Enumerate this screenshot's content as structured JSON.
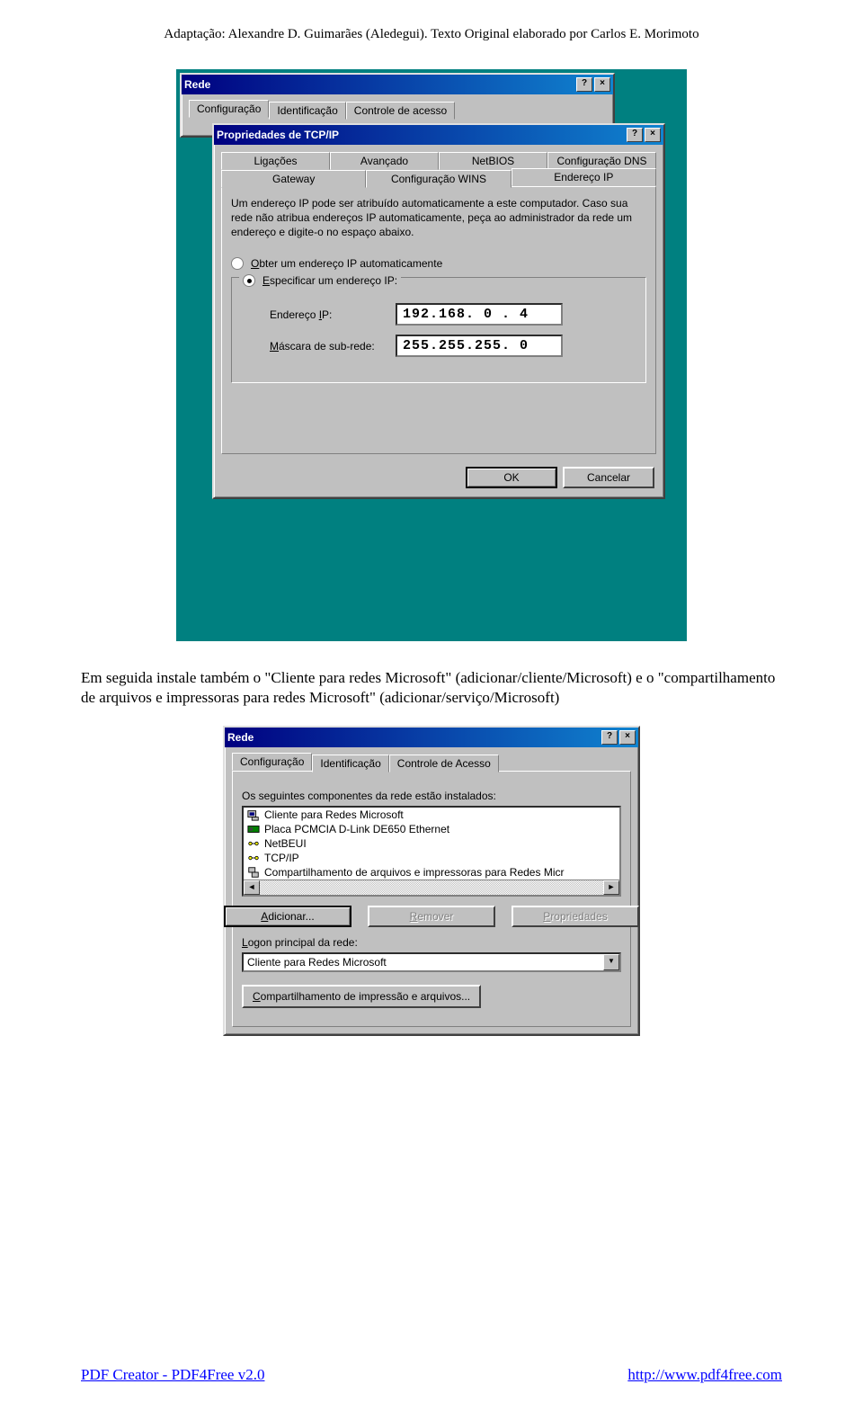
{
  "header": "Adaptação: Alexandre D. Guimarães (Aledegui). Texto Original elaborado por Carlos E. Morimoto",
  "screenshot1": {
    "back_window": {
      "title": "Rede",
      "tabs": [
        "Configuração",
        "Identificação",
        "Controle de acesso"
      ]
    },
    "front_window": {
      "title": "Propriedades de TCP/IP",
      "tabs_row1": [
        "Ligações",
        "Avançado",
        "NetBIOS",
        "Configuração DNS"
      ],
      "tabs_row2": [
        "Gateway",
        "Configuração WINS",
        "Endereço IP"
      ],
      "explain": "Um endereço IP pode ser atribuído automaticamente a este computador. Caso sua rede não atribua endereços IP automaticamente, peça ao administrador da rede um endereço e digite-o no espaço abaixo.",
      "radio_auto": "Obter um endereço IP automaticamente",
      "radio_spec": "Especificar um endereço IP:",
      "ip_label": "Endereço IP:",
      "ip_value": "192.168. 0 . 4",
      "mask_label": "Máscara de sub-rede:",
      "mask_value": "255.255.255. 0",
      "ok": "OK",
      "cancel": "Cancelar"
    }
  },
  "body_paragraph": "Em seguida instale também o \"Cliente para redes Microsoft\" (adicionar/cliente/Microsoft) e o \"compartilhamento de arquivos e impressoras para redes Microsoft\" (adicionar/serviço/Microsoft)",
  "screenshot2": {
    "title": "Rede",
    "tabs": [
      "Configuração",
      "Identificação",
      "Controle de Acesso"
    ],
    "list_caption": "Os seguintes componentes da rede estão instalados:",
    "items": [
      "Cliente para Redes Microsoft",
      "Placa PCMCIA D-Link DE650 Ethernet",
      "NetBEUI",
      "TCP/IP",
      "Compartilhamento de arquivos e impressoras para Redes Micr"
    ],
    "btn_add": "Adicionar...",
    "btn_remove": "Remover",
    "btn_props": "Propriedades",
    "logon_label": "Logon principal da rede:",
    "logon_value": "Cliente para Redes Microsoft",
    "btn_share": "Compartilhamento de impressão e arquivos..."
  },
  "footer_left": "PDF Creator - PDF4Free v2.0",
  "footer_right": "http://www.pdf4free.com"
}
